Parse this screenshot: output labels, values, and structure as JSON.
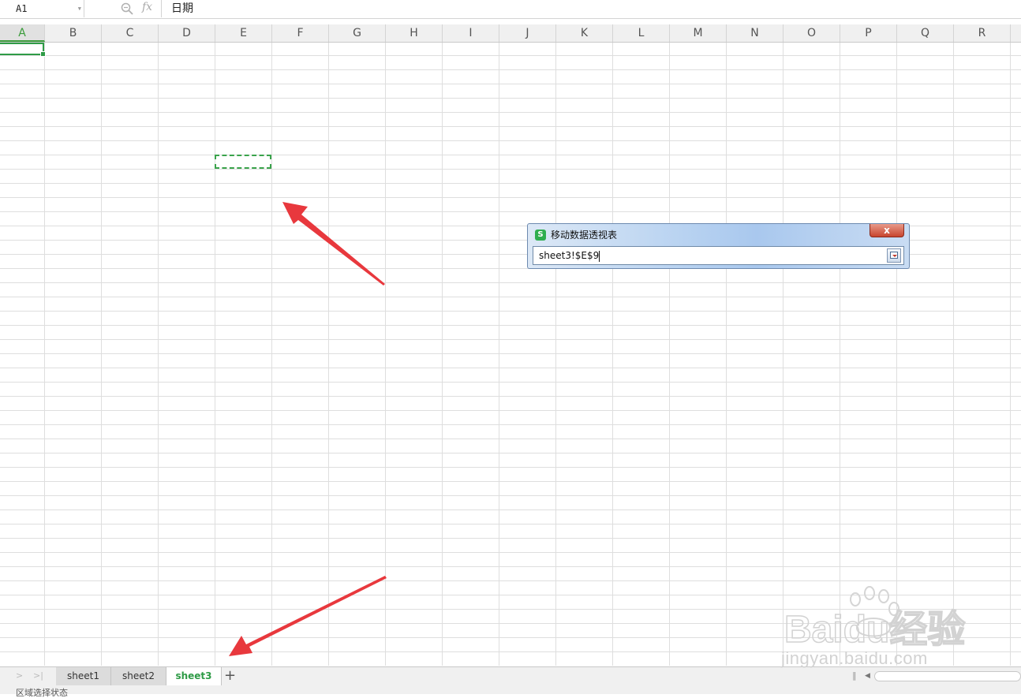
{
  "formula_bar": {
    "cell_reference": "A1",
    "formula_value": "日期",
    "fx_label": "fx"
  },
  "columns": [
    "A",
    "B",
    "C",
    "D",
    "E",
    "F",
    "G",
    "H",
    "I",
    "J",
    "K",
    "L",
    "M",
    "N",
    "O",
    "P",
    "Q",
    "R"
  ],
  "active_cell": "A1",
  "dialog": {
    "title": "移动数据透视表",
    "close_label": "x",
    "icon_label": "S",
    "input_value": "sheet3!$E$9"
  },
  "sheet_tabs": {
    "tabs": [
      "sheet1",
      "sheet2",
      "sheet3"
    ],
    "active": "sheet3",
    "add_label": "+"
  },
  "status_bar": {
    "text": "区域选择状态"
  },
  "watermark": {
    "brand": "Baidu经验",
    "url": "jingyan.baidu.com"
  },
  "colors": {
    "accent_green": "#2e9b46",
    "annotation_red": "#e8383d",
    "dialog_title_bar": "#b9d3f1"
  }
}
